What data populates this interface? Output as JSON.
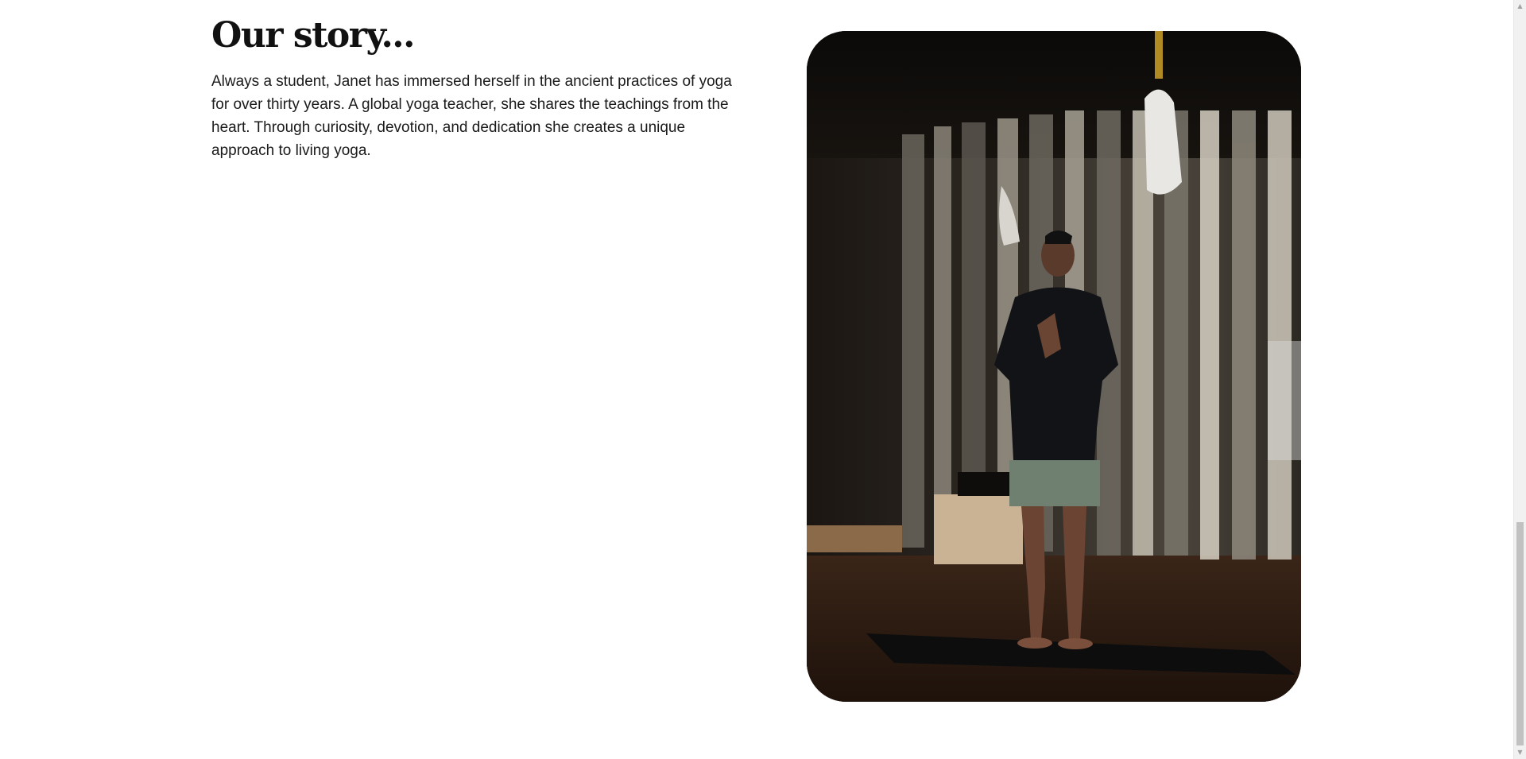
{
  "story": {
    "heading": "Our story...",
    "body": "Always a student, Janet has immersed herself in the ancient practices of yoga for over thirty years. A global yoga teacher, she shares the teachings from the heart. Through curiosity, devotion, and dedication she creates a unique approach to living yoga."
  },
  "icons": {
    "scroll_up": "▲",
    "scroll_down": "▼"
  },
  "colors": {
    "heading": "#111111",
    "body_text": "#1a1a1a",
    "background": "#ffffff"
  }
}
